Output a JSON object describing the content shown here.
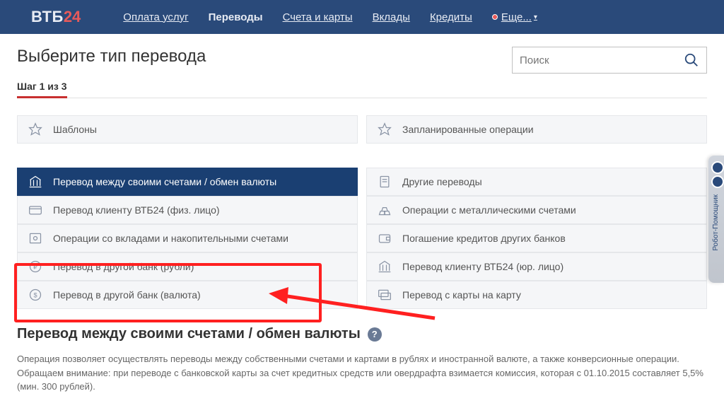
{
  "logo": {
    "name": "ВТБ",
    "suffix": "24"
  },
  "nav": {
    "items": [
      {
        "label": "Оплата услуг"
      },
      {
        "label": "Переводы",
        "active": true
      },
      {
        "label": "Счета и карты"
      },
      {
        "label": "Вклады"
      },
      {
        "label": "Кредиты"
      },
      {
        "label": "Еще..."
      }
    ]
  },
  "page_title": "Выберите тип перевода",
  "search": {
    "placeholder": "Поиск"
  },
  "step": {
    "label": "Шаг 1 из 3"
  },
  "tiles": {
    "left_header": "Шаблоны",
    "right_header": "Запланированные операции",
    "left": [
      "Перевод между своими счетами / обмен валюты",
      "Перевод клиенту ВТБ24 (физ. лицо)",
      "Операции со вкладами и накопительными счетами",
      "Перевод в другой банк (рубли)",
      "Перевод в другой банк (валюта)"
    ],
    "right": [
      "Другие переводы",
      "Операции с металлическими счетами",
      "Погашение кредитов других банков",
      "Перевод клиенту ВТБ24 (юр. лицо)",
      "Перевод с карты на карту"
    ]
  },
  "section": {
    "title": "Перевод между своими счетами / обмен валюты",
    "text": "Операция позволяет осуществлять переводы между собственными счетами и картами в рублях и иностранной валюте, а также конверсионные операции. Обращаем внимание: при переводе с банковской карты за счет кредитных средств или овердрафта взимается комиссия, которая с 01.10.2015 составляет 5,5% (мин. 300 рублей)."
  },
  "side_widget": {
    "text": "Робот-Помощник"
  }
}
